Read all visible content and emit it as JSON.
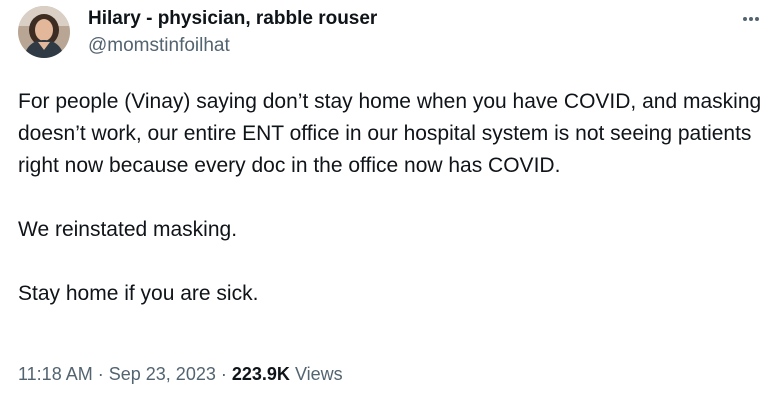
{
  "author": {
    "display_name": "Hilary - physician, rabble rouser",
    "handle": "@momstinfoilhat"
  },
  "tweet": {
    "paragraphs": [
      "For people (Vinay) saying don’t stay home when you have COVID, and masking doesn’t work, our entire ENT office in our hospital system is not seeing patients right now because every doc in the office now has COVID.",
      "We reinstated masking.",
      "Stay home if you are sick."
    ]
  },
  "meta": {
    "time": "11:18 AM",
    "separator": "·",
    "date": "Sep 23, 2023",
    "views_count": "223.9K",
    "views_label": "Views"
  },
  "icons": {
    "more": "more-options-icon",
    "avatar": "avatar"
  },
  "colors": {
    "text_primary": "#0f1419",
    "text_secondary": "#536471"
  }
}
